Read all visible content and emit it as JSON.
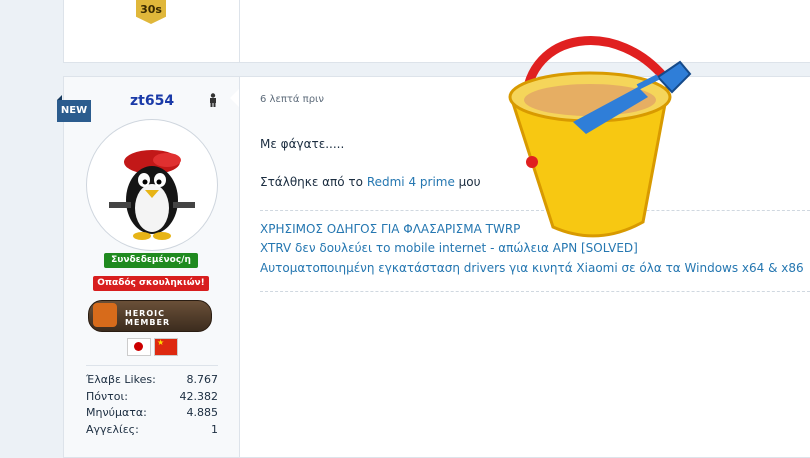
{
  "top_post": {
    "badge": "30s"
  },
  "user": {
    "new_tag": "NEW",
    "name": "zt654",
    "status_online": "Συνδεδεμένος/η",
    "role": "Οπαδός σκουληκιών!",
    "badge_text": "HEROIC MEMBER",
    "flags": [
      "japan-flag",
      "china-flag"
    ],
    "stats": [
      {
        "label": "Έλαβε Likes:",
        "value": "8.767"
      },
      {
        "label": "Πόντοι:",
        "value": "42.382"
      },
      {
        "label": "Μηνύματα:",
        "value": "4.885"
      },
      {
        "label": "Αγγελίες:",
        "value": "1"
      }
    ]
  },
  "post": {
    "time": "6 λεπτά πριν",
    "body_line1": "Με φάγατε.....",
    "sent_from_prefix": "Στάλθηκε από το ",
    "sent_from_device": "Redmi 4 prime",
    "sent_from_suffix": " μου",
    "signature_links": [
      "ΧΡΗΣΙΜΟΣ ΟΔΗΓΟΣ ΓΙΑ ΦΛΑΣΑΡΙΣΜΑ TWRP",
      "XTRV δεν δουλεύει το mobile internet - απώλεια APN [SOLVED]",
      "Αυτοματοποιημένη εγκατάσταση drivers για κινητά Xiaomi σε όλα τα Windows x64 & x86"
    ]
  },
  "colors": {
    "link": "#2577b1",
    "username": "#1a3aa8",
    "online": "#1f8a1f",
    "role": "#d81e1e"
  }
}
